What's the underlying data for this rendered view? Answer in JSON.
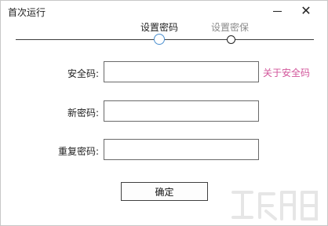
{
  "window": {
    "title": "首次运行"
  },
  "steps": [
    {
      "label": "设置密码",
      "state": "active"
    },
    {
      "label": "设置密保",
      "state": "inactive"
    }
  ],
  "form": {
    "security_code_label": "安全码:",
    "security_code_value": "",
    "about_link": "关于安全码",
    "new_password_label": "新密码:",
    "new_password_value": "",
    "confirm_password_label": "重复密码:",
    "confirm_password_value": ""
  },
  "buttons": {
    "ok": "确定"
  },
  "colors": {
    "active_step": "#4b8fcf",
    "link": "#d2569b"
  },
  "icons": {
    "minimize": "minimize-icon",
    "close": "close-icon",
    "watermark": "site-logo-watermark"
  }
}
